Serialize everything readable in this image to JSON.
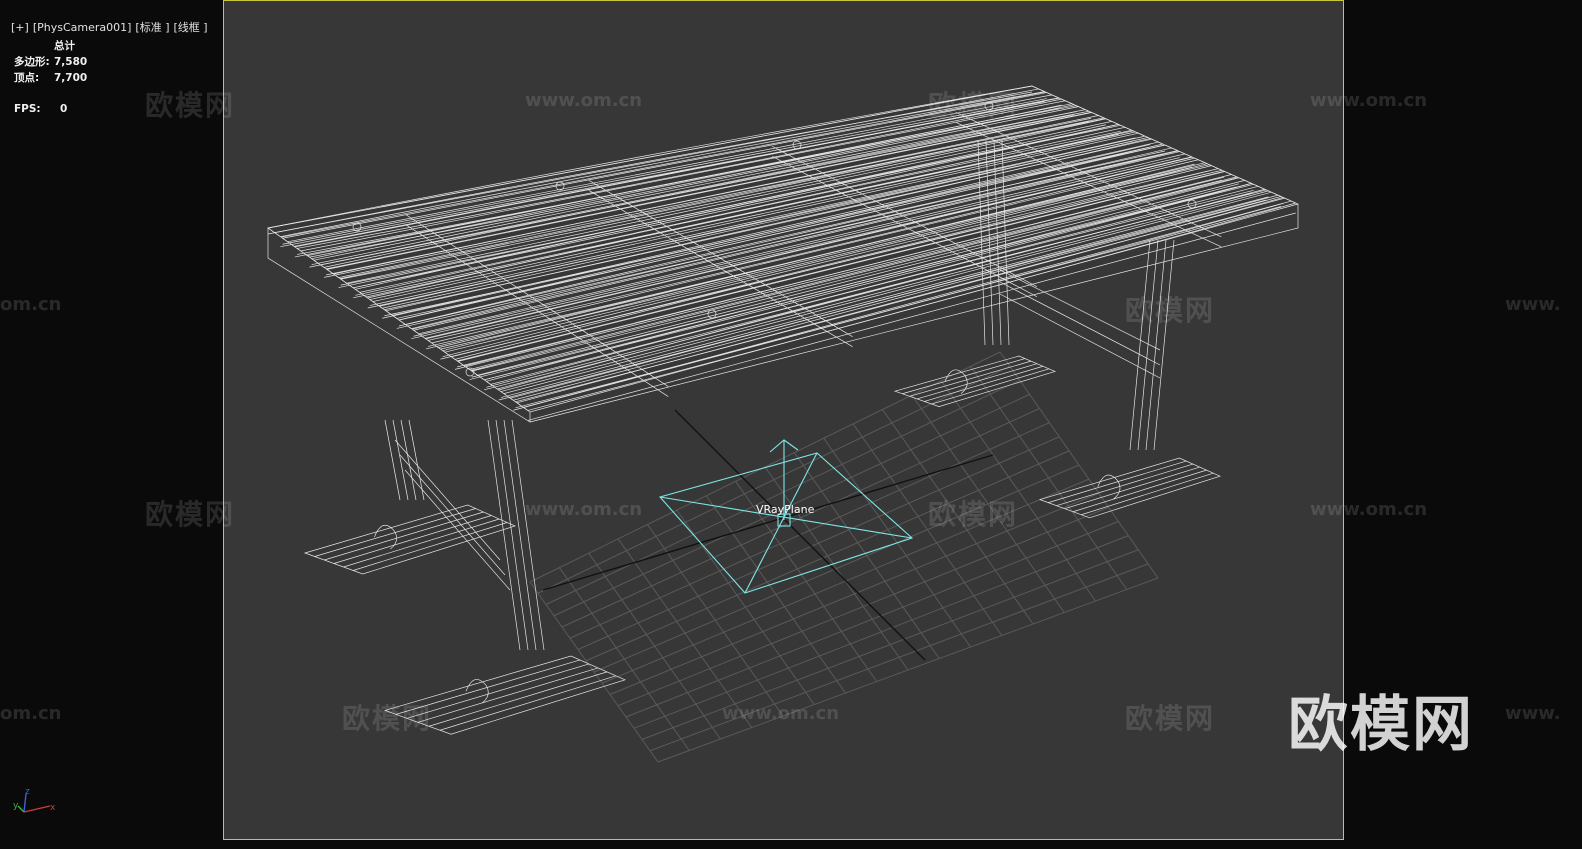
{
  "viewport": {
    "label_parts": [
      "[+]",
      "[PhysCamera001]",
      "[标准 ]",
      "[线框 ]"
    ]
  },
  "stats": {
    "header": "总计",
    "polygons_label": "多边形:",
    "polygons_value": "7,580",
    "vertices_label": "顶点:",
    "vertices_value": "7,700",
    "fps_label": "FPS:",
    "fps_value": "0"
  },
  "scene": {
    "object_label": "VRayPlane",
    "wire_color": "#e6e6e6",
    "selected_color": "#7fe6e6",
    "safe_frame_color": "#c8c83a"
  },
  "watermarks": {
    "url": "www.om.cn",
    "brand": "欧模网",
    "url_left": "om.cn",
    "url_right": "www."
  },
  "logo": "欧模网",
  "axis_gizmo": {
    "x": "x",
    "y": "y",
    "z": "z"
  }
}
